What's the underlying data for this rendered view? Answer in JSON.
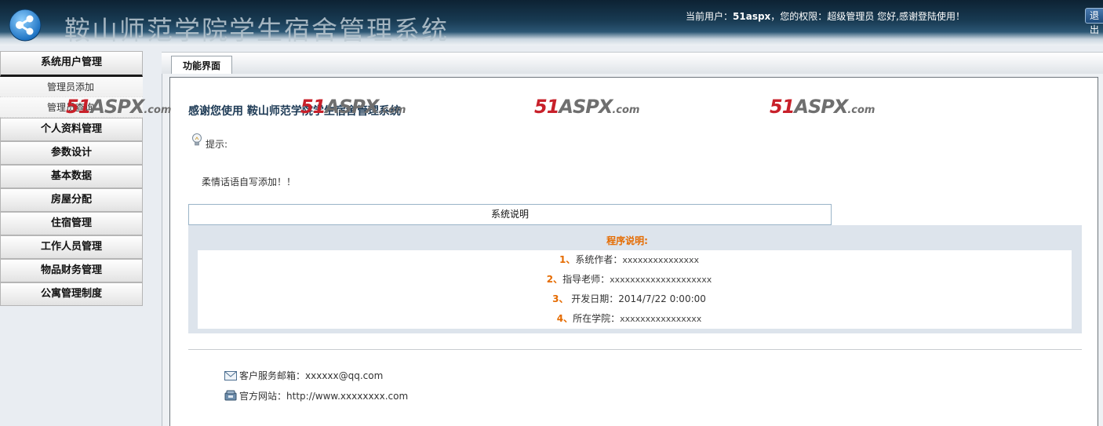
{
  "header": {
    "title": "鞍山师范学院学生宿舍管理系统",
    "user_prefix": "当前用户：",
    "username": "51aspx",
    "user_middle": "，您的权限：",
    "role": "超级管理员",
    "user_suffix": "  您好,感谢登陆使用！",
    "logout_label": "退出"
  },
  "sidebar": {
    "sections": [
      {
        "label": "系统用户管理",
        "open": true,
        "items": [
          "管理员添加",
          "管理员查询"
        ]
      },
      {
        "label": "个人资料管理"
      },
      {
        "label": "参数设计"
      },
      {
        "label": "基本数据"
      },
      {
        "label": "房屋分配"
      },
      {
        "label": "住宿管理"
      },
      {
        "label": "工作人员管理"
      },
      {
        "label": "物品财务管理"
      },
      {
        "label": "公寓管理制度"
      }
    ]
  },
  "tabs": [
    {
      "label": "功能界面"
    }
  ],
  "main": {
    "welcome": "感谢您使用 鞍山师范学院学生宿舍管理系统",
    "tip_label": "提示:",
    "tip_message": "柔情话语自写添加！！",
    "description_header": "系统说明",
    "program_title": "程序说明:",
    "items": [
      {
        "num": "1、",
        "label": "系统作者：",
        "value": "xxxxxxxxxxxxxxx"
      },
      {
        "num": "2、",
        "label": "指导老师：",
        "value": "xxxxxxxxxxxxxxxxxxxx"
      },
      {
        "num": "3、",
        "label": " 开发日期：",
        "value": "2014/7/22 0:00:00"
      },
      {
        "num": "4、",
        "label": "所在学院：",
        "value": "xxxxxxxxxxxxxxxx"
      }
    ],
    "email_label": "客户服务邮箱：",
    "email_value": "xxxxxx@qq.com",
    "website_label": "官方网站：",
    "website_value": "http://www.xxxxxxxx.com"
  },
  "watermark": {
    "num": "51",
    "brand": "ASPX",
    "domain": ".com"
  },
  "colors": {
    "accent": "#e56b00",
    "header_dark": "#0d2233",
    "watermark_red": "#c8202a"
  }
}
